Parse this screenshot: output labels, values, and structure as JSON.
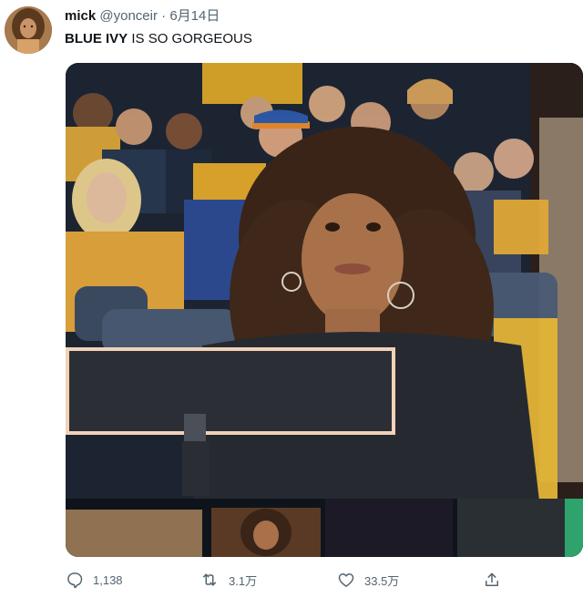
{
  "tweet": {
    "display_name": "mick",
    "handle": "@yonceir",
    "separator": "·",
    "date": "6月14日",
    "text_bold": "BLUE IVY",
    "text_rest": " IS SO GORGEOUS"
  },
  "actions": {
    "reply_count": "1,138",
    "retweet_count": "3.1万",
    "like_count": "33.5万",
    "share_label": ""
  },
  "icons": {
    "reply": "reply-icon",
    "retweet": "retweet-icon",
    "like": "like-icon",
    "share": "share-icon"
  },
  "colors": {
    "text_primary": "#0f1419",
    "text_secondary": "#536471"
  }
}
